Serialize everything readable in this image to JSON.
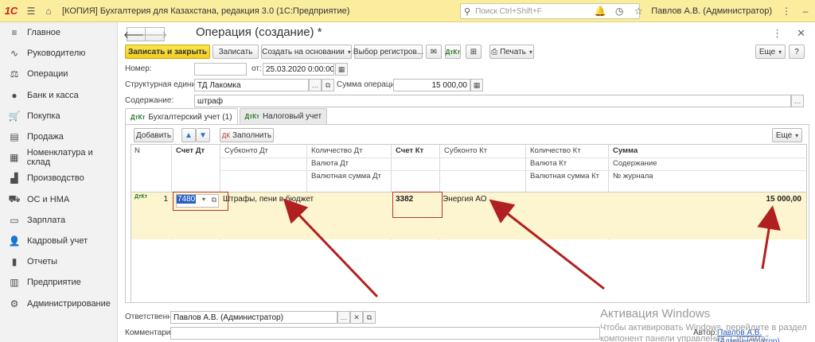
{
  "app": {
    "logo": "1С",
    "title": "[КОПИЯ] Бухгалтерия для Казахстана, редакция 3.0  (1С:Предприятие)",
    "search_placeholder": "Поиск Ctrl+Shift+F",
    "user": "Павлов А.В. (Администратор)"
  },
  "sidebar": {
    "items": [
      {
        "label": "Главное",
        "icon": "menu-icon"
      },
      {
        "label": "Руководителю",
        "icon": "trend-icon"
      },
      {
        "label": "Операции",
        "icon": "operations-icon"
      },
      {
        "label": "Банк и касса",
        "icon": "bank-icon"
      },
      {
        "label": "Покупка",
        "icon": "cart-icon"
      },
      {
        "label": "Продажа",
        "icon": "sale-icon"
      },
      {
        "label": "Номенклатура и склад",
        "icon": "grid-icon"
      },
      {
        "label": "Производство",
        "icon": "factory-icon"
      },
      {
        "label": "ОС и НМА",
        "icon": "truck-icon"
      },
      {
        "label": "Зарплата",
        "icon": "salary-icon"
      },
      {
        "label": "Кадровый учет",
        "icon": "people-icon"
      },
      {
        "label": "Отчеты",
        "icon": "reports-icon"
      },
      {
        "label": "Предприятие",
        "icon": "building-icon"
      },
      {
        "label": "Администрирование",
        "icon": "gear-icon"
      }
    ]
  },
  "form": {
    "title": "Операция (создание) *",
    "buttons": {
      "save_close": "Записать и закрыть",
      "save": "Записать",
      "create_based": "Создать на основании",
      "registers": "Выбор регистров...",
      "print": "Печать",
      "more": "Еще"
    },
    "fields": {
      "number_label": "Номер:",
      "number_value": "",
      "date_label": "от:",
      "date_value": "25.03.2020  0:00:00",
      "unit_label": "Структурная единица:",
      "unit_value": "ТД Лакомка",
      "amount_label": "Сумма операции:",
      "amount_value": "15 000,00",
      "content_label": "Содержание:",
      "content_value": "штраф"
    },
    "tabs": [
      {
        "label": "Бухгалтерский учет (1)",
        "active": true
      },
      {
        "label": "Налоговый учет",
        "active": false
      }
    ],
    "table_toolbar": {
      "add": "Добавить",
      "fill": "Заполнить",
      "more": "Еще"
    },
    "columns": {
      "n": "N",
      "dt_account": "Счет Дт",
      "dt_subconto": "Субконто Дт",
      "dt_qty": "Количество Дт",
      "dt_currency": "Валюта Дт",
      "dt_cur_sum": "Валютная сумма Дт",
      "kt_account": "Счет Кт",
      "kt_subconto": "Субконто Кт",
      "kt_qty": "Количество Кт",
      "kt_currency": "Валюта Кт",
      "kt_cur_sum": "Валютная сумма Кт",
      "sum": "Сумма",
      "content": "Содержание",
      "journal": "№ журнала"
    },
    "rows": [
      {
        "n": "1",
        "dt_account": "7480",
        "dt_subconto": "Штрафы, пени в бюджет",
        "kt_account": "3382",
        "kt_subconto": "Энергия АО",
        "sum": "15 000,00"
      }
    ],
    "footer": {
      "responsible_label": "Ответственный:",
      "responsible_value": "Павлов А.В. (Администратор)",
      "comment_label": "Комментарий:",
      "comment_value": "",
      "author_label": "Автор:",
      "author_value": "Павлов А.В. (Администратор)"
    }
  },
  "watermark": {
    "line1": "Активация Windows",
    "line2": "Чтобы активировать Windows, перейдите в раздел",
    "line3": "компонент панели управления \"Система\""
  }
}
